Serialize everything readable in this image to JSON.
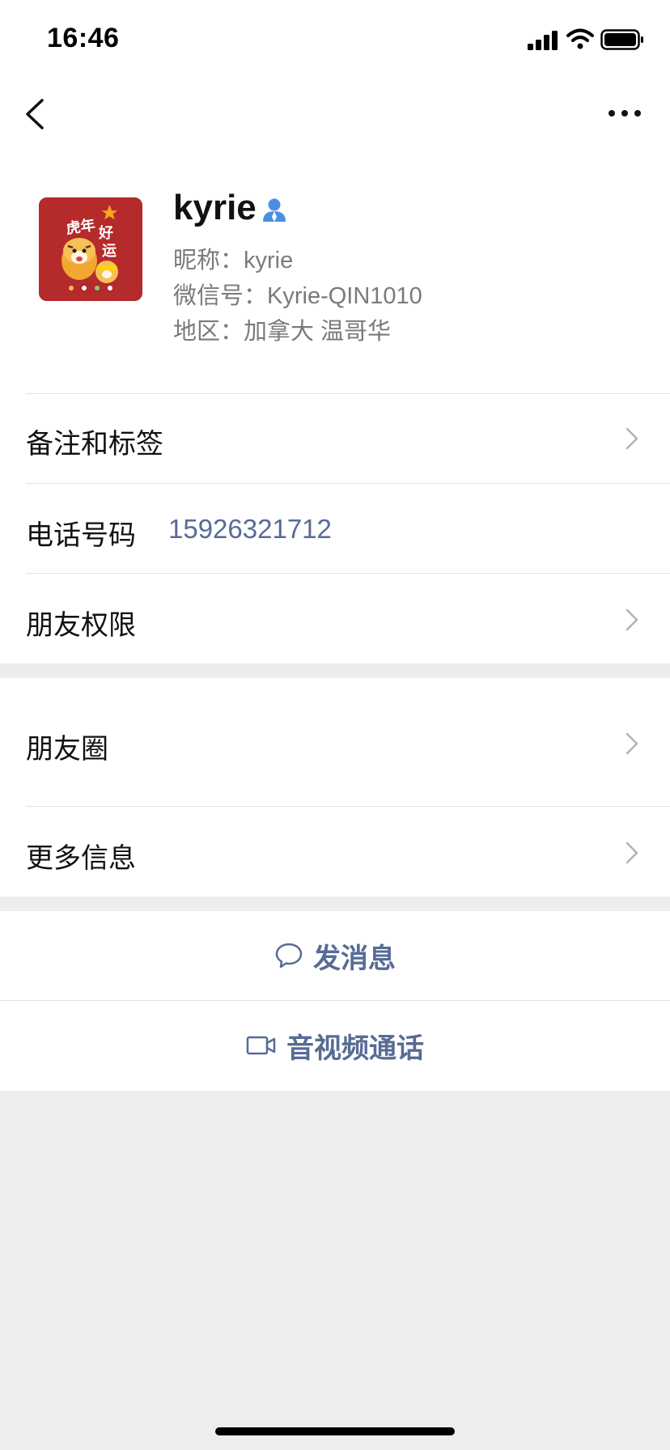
{
  "status_bar": {
    "time": "16:46"
  },
  "profile": {
    "name": "kyrie",
    "nickname": "昵称：kyrie",
    "wechat_id": "微信号：Kyrie-QIN1010",
    "region": "地区：加拿大 温哥华",
    "avatar_text": "虎年好运"
  },
  "rows": {
    "remark": {
      "label": "备注和标签"
    },
    "phone": {
      "label": "电话号码",
      "value": "15926321712"
    },
    "permissions": {
      "label": "朋友权限"
    },
    "moments": {
      "label": "朋友圈"
    },
    "more_info": {
      "label": "更多信息"
    }
  },
  "actions": {
    "message": {
      "label": "发消息",
      "icon": "chat-bubble-icon"
    },
    "call": {
      "label": "音视频通话",
      "icon": "video-camera-icon"
    }
  },
  "colors": {
    "link": "#576b95",
    "background": "#ededed",
    "verified": "#4a90e2",
    "avatar_bg": "#b52a2a"
  }
}
